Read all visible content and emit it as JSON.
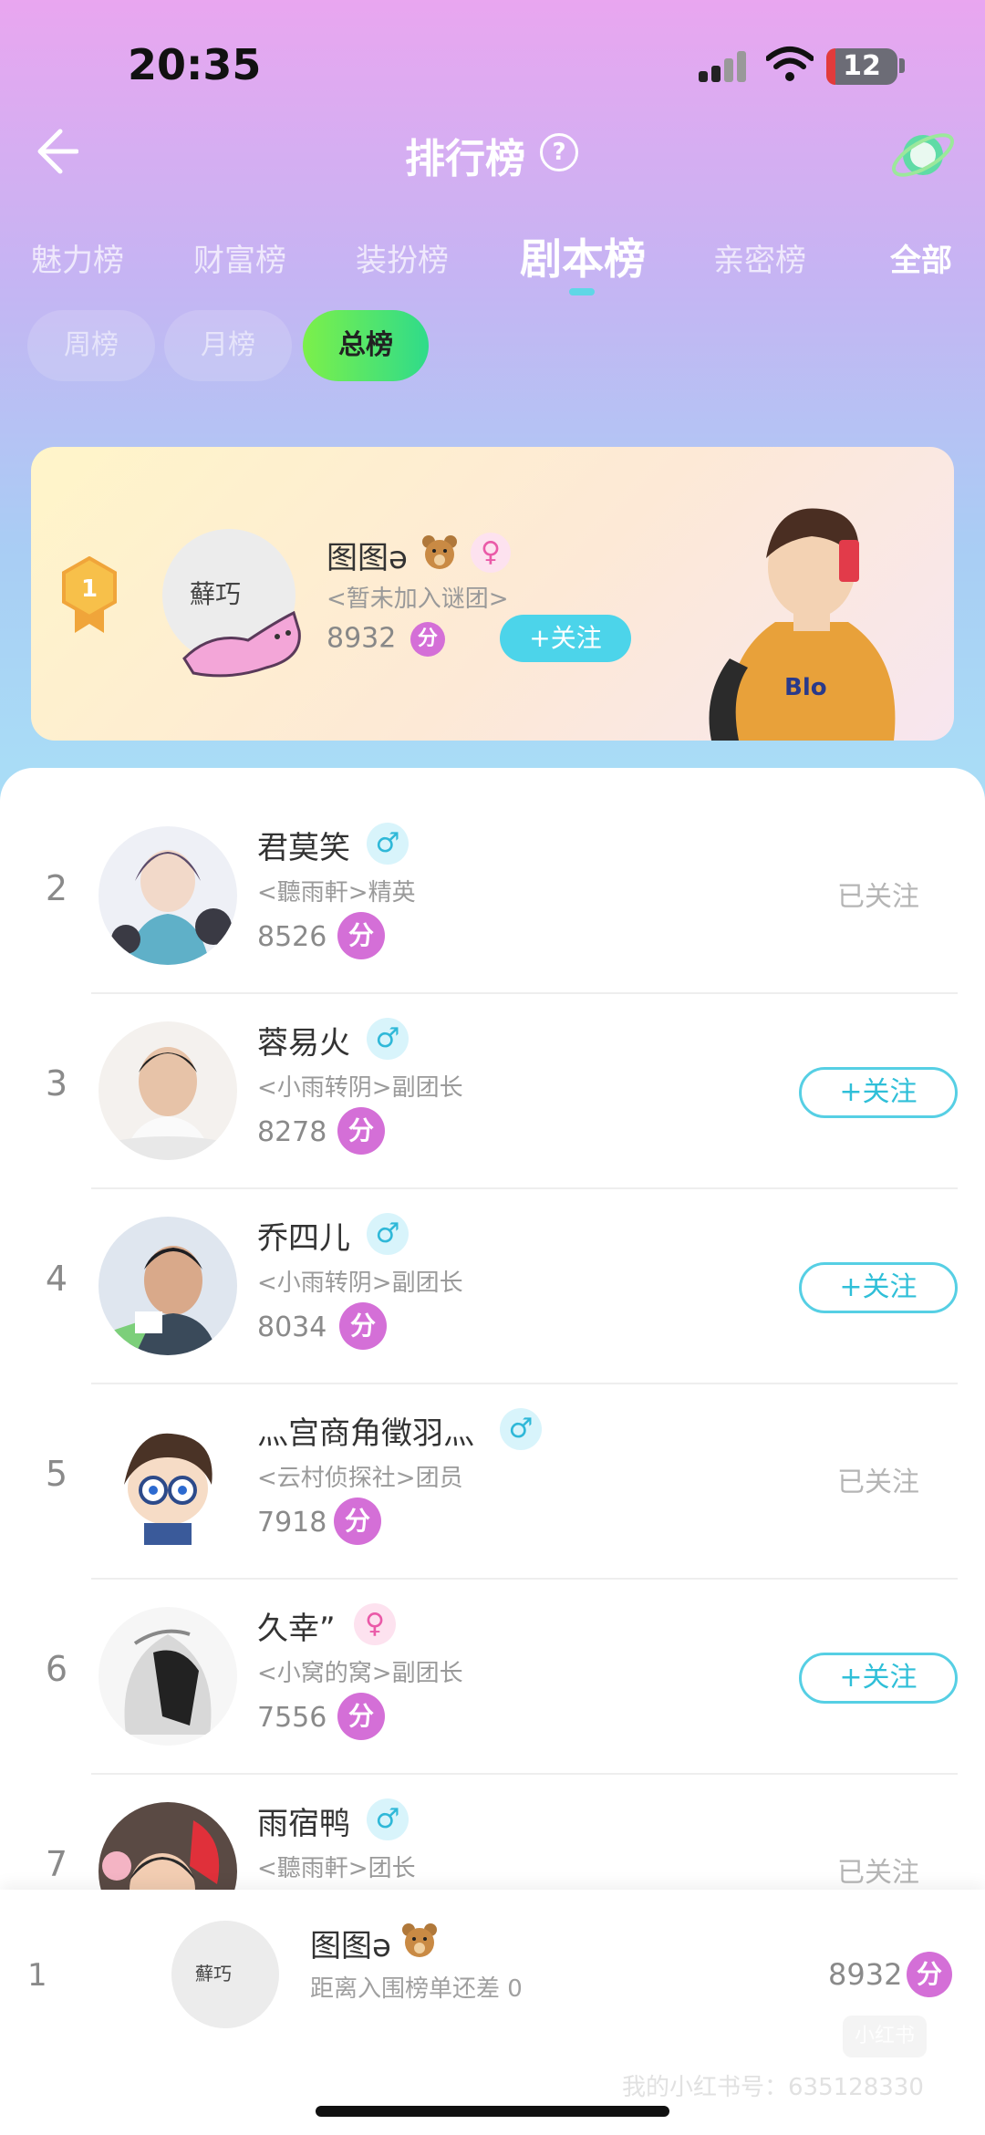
{
  "status_bar": {
    "time": "20:35",
    "battery": "12"
  },
  "header": {
    "title": "排行榜",
    "help_glyph": "?"
  },
  "tabs": [
    {
      "label": "魅力榜"
    },
    {
      "label": "财富榜"
    },
    {
      "label": "装扮榜"
    },
    {
      "label": "剧本榜",
      "active": true
    },
    {
      "label": "亲密榜"
    }
  ],
  "tab_all": "全部",
  "periods": [
    {
      "label": "周榜"
    },
    {
      "label": "月榜"
    },
    {
      "label": "总榜",
      "active": true
    }
  ],
  "top_user": {
    "rank": "1",
    "avatar_text": "蘚巧",
    "name": "图图ə",
    "gender_glyph": "♀",
    "group": "<暂未加入谜团>",
    "score": "8932",
    "score_unit": "分",
    "follow_label": "+关注"
  },
  "rows": [
    {
      "rank": "2",
      "name": "君莫笑",
      "gender": "♂",
      "group": "<聽雨軒>精英",
      "score": "8526",
      "unit": "分",
      "action": "已关注"
    },
    {
      "rank": "3",
      "name": "蓉易火",
      "gender": "♂",
      "group": "<小雨转阴>副团长",
      "score": "8278",
      "unit": "分",
      "action": "+关注"
    },
    {
      "rank": "4",
      "name": "乔四儿",
      "gender": "♂",
      "group": "<小雨转阴>副团长",
      "score": "8034",
      "unit": "分",
      "action": "+关注"
    },
    {
      "rank": "5",
      "name": "灬宫商角徵羽灬",
      "gender": "♂",
      "group": "<云村侦探社>团员",
      "score": "7918",
      "unit": "分",
      "action": "已关注"
    },
    {
      "rank": "6",
      "name": "久幸”",
      "gender": "♀",
      "group": "<小窝的窝>副团长",
      "score": "7556",
      "unit": "分",
      "action": "+关注"
    },
    {
      "rank": "7",
      "name": "雨宿鸭",
      "gender": "♂",
      "group": "<聽雨軒>团长",
      "score": "",
      "unit": "",
      "action": "已关注"
    }
  ],
  "my_rank": {
    "rank": "1",
    "avatar_text": "蘚巧",
    "name": "图图ə",
    "sub": "距离入围榜单还差 0",
    "score": "8932",
    "unit": "分"
  },
  "watermark": "我的小红书号：635128330",
  "watermark_logo": "小红书",
  "colors": {
    "accent": "#4cd4ea",
    "score_badge": "#d46fd7",
    "active_pill": "#7cf04a"
  }
}
